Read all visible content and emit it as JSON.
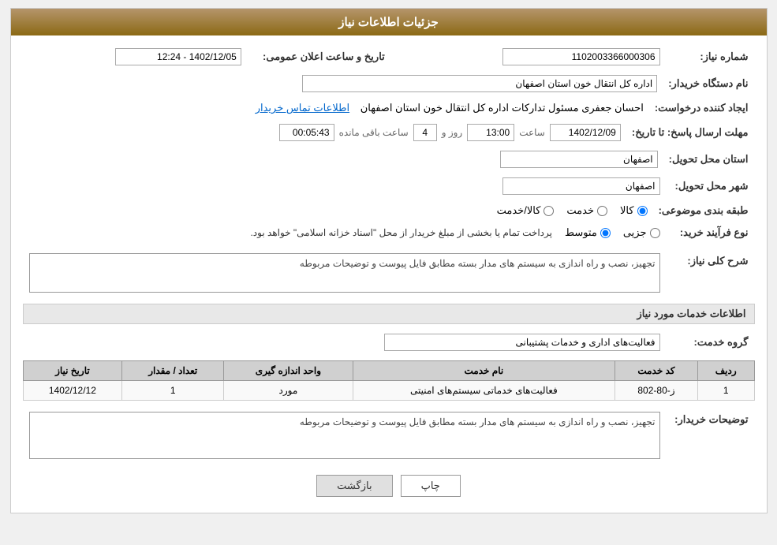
{
  "header": {
    "title": "جزئیات اطلاعات نیاز"
  },
  "fields": {
    "need_number_label": "شماره نیاز:",
    "need_number_value": "1102003366000306",
    "datetime_label": "تاریخ و ساعت اعلان عمومی:",
    "datetime_value": "1402/12/05 - 12:24",
    "buyer_org_label": "نام دستگاه خریدار:",
    "buyer_org_value": "اداره کل انتقال خون استان اصفهان",
    "creator_label": "ایجاد کننده درخواست:",
    "creator_value": "احسان جعفری مسئول تدارکات اداره کل انتقال خون استان اصفهان",
    "contact_link": "اطلاعات تماس خریدار",
    "response_deadline_label": "مهلت ارسال پاسخ: تا تاریخ:",
    "deadline_date": "1402/12/09",
    "deadline_time_label": "ساعت",
    "deadline_time": "13:00",
    "deadline_days_label": "روز و",
    "deadline_days": "4",
    "deadline_remaining_label": "ساعت باقی مانده",
    "deadline_remaining": "00:05:43",
    "delivery_province_label": "استان محل تحویل:",
    "delivery_province_value": "اصفهان",
    "delivery_city_label": "شهر محل تحویل:",
    "delivery_city_value": "اصفهان",
    "category_label": "طبقه بندی موضوعی:",
    "category_options": [
      "کالا",
      "خدمت",
      "کالا/خدمت"
    ],
    "category_selected": "کالا",
    "purchase_type_label": "نوع فرآیند خرید:",
    "purchase_type_options": [
      "جزیی",
      "متوسط"
    ],
    "purchase_type_note": "پرداخت تمام یا بخشی از مبلغ خریدار از محل \"اسناد خزانه اسلامی\" خواهد بود.",
    "overall_desc_label": "شرح کلی نیاز:",
    "overall_desc_value": "تجهیز، نصب و راه اندازی به سیستم های مدار بسته مطابق فایل پیوست و توضیحات مربوطه"
  },
  "services_section": {
    "title": "اطلاعات خدمات مورد نیاز",
    "service_group_label": "گروه خدمت:",
    "service_group_value": "فعالیت‌های اداری و خدمات پشتیبانی",
    "table_headers": [
      "ردیف",
      "کد خدمت",
      "نام خدمت",
      "واحد اندازه گیری",
      "تعداد / مقدار",
      "تاریخ نیاز"
    ],
    "table_rows": [
      {
        "row": "1",
        "code": "ز-80-802",
        "name": "فعالیت‌های خدماتی سیستم‌های امنیتی",
        "unit": "مورد",
        "quantity": "1",
        "date": "1402/12/12"
      }
    ]
  },
  "buyer_desc_label": "توضیحات خریدار:",
  "buyer_desc_value": "تجهیز، نصب و راه اندازی به سیستم های مدار بسته مطابق فایل پیوست و توضیحات مربوطه",
  "buttons": {
    "print_label": "چاپ",
    "back_label": "بازگشت"
  }
}
